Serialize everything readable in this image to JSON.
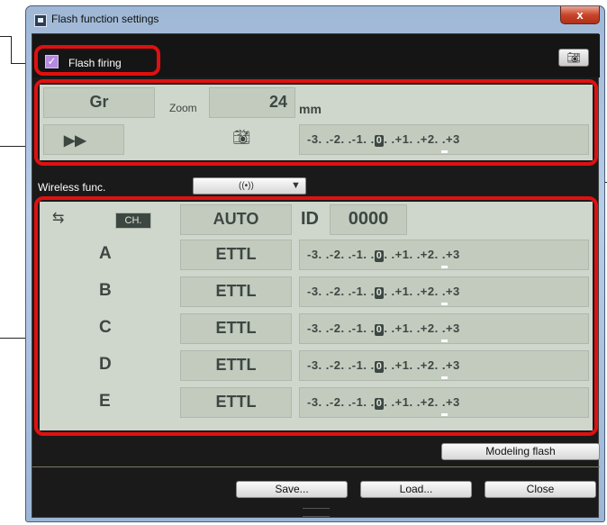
{
  "window": {
    "title": "Flash function settings",
    "close_glyph": "x"
  },
  "flash_firing": {
    "checked": true,
    "label": "Flash firing"
  },
  "top_panel": {
    "mode": "Gr",
    "zoom_label": "Zoom",
    "zoom_value": "24",
    "zoom_unit": "mm",
    "sync_icon": "high-speed-sync-icon",
    "fec_icon": "flash-exposure-compensation-icon",
    "scale_left": "-3. .-2. .-1. .",
    "scale_zero": "0",
    "scale_right": ". .+1. .+2. .+3"
  },
  "wireless": {
    "label": "Wireless func.",
    "dropdown_icon": "((•))",
    "dropdown_arrow": "▼"
  },
  "wireless_panel": {
    "ratio_icon": "flash-ratio-icon",
    "channel_label": "CH.",
    "channel_value": "AUTO",
    "id_label": "ID",
    "id_value": "0000",
    "groups": [
      {
        "name": "A",
        "mode": "ETTL"
      },
      {
        "name": "B",
        "mode": "ETTL"
      },
      {
        "name": "C",
        "mode": "ETTL"
      },
      {
        "name": "D",
        "mode": "ETTL"
      },
      {
        "name": "E",
        "mode": "ETTL"
      }
    ],
    "scale_left": "-3. .-2. .-1. .",
    "scale_zero": "0",
    "scale_right": ". .+1. .+2. .+3"
  },
  "buttons": {
    "modeling_flash": "Modeling flash",
    "save": "Save...",
    "load": "Load...",
    "close": "Close"
  },
  "colors": {
    "highlight": "#e01010",
    "panel": "#cfd6cc",
    "cell": "#c3cbbf",
    "text": "#3d4742"
  }
}
